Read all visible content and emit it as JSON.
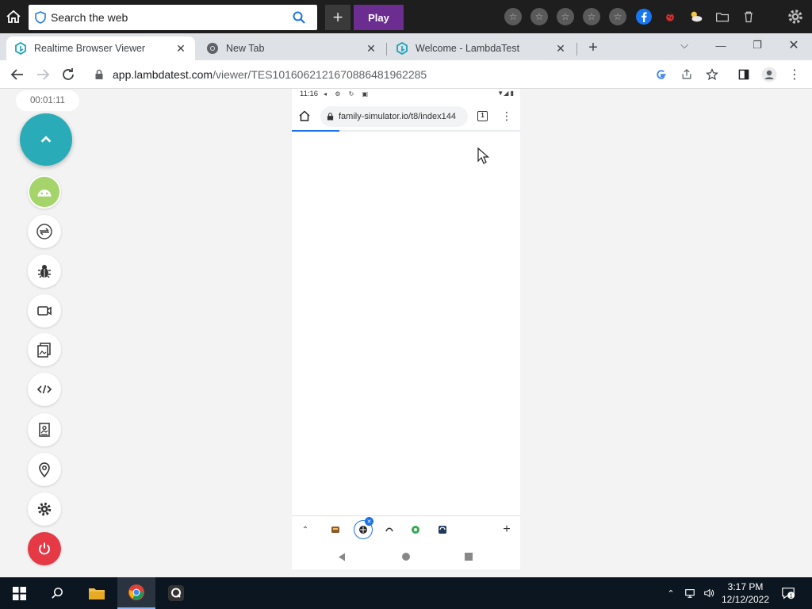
{
  "launcher": {
    "search_placeholder": "Search the web",
    "play_label": "Play",
    "plus_label": "+"
  },
  "tabs": [
    {
      "label": "Realtime Browser Viewer",
      "active": true
    },
    {
      "label": "New Tab",
      "active": false
    },
    {
      "label": "Welcome - LambdaTest",
      "active": false
    }
  ],
  "address": {
    "host": "app.lambdatest.com",
    "path": "/viewer/TES1016062121670886481962285"
  },
  "viewer": {
    "timer": "00:01:11",
    "tools": [
      "android-icon",
      "rotate-icon",
      "bug-icon",
      "video-icon",
      "gallery-icon",
      "code-icon",
      "photo-icon",
      "location-icon",
      "settings-icon",
      "power-icon"
    ]
  },
  "phone": {
    "status_time": "11:16",
    "url": "family-simulator.io/t8/index144",
    "tab_count": "1",
    "page_load_progress": 0.21
  },
  "taskbar": {
    "time": "3:17 PM",
    "date": "12/12/2022",
    "notification_count": "1"
  },
  "colors": {
    "teal_fab": "#2aacb8",
    "power_red": "#e53946",
    "android_green": "#a4d46a",
    "play_purple": "#6b2d8f"
  }
}
